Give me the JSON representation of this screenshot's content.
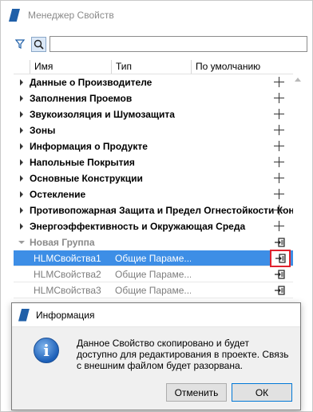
{
  "window": {
    "title": "Менеджер Свойств"
  },
  "search": {
    "value": "",
    "placeholder": ""
  },
  "columns": {
    "name": "Имя",
    "type": "Тип",
    "default": "По умолчанию"
  },
  "groups": [
    {
      "label": "Данные о Производителе"
    },
    {
      "label": "Заполнения Проемов"
    },
    {
      "label": "Звукоизоляция и Шумозащита"
    },
    {
      "label": "Зоны"
    },
    {
      "label": "Информация о Продукте"
    },
    {
      "label": "Напольные Покрытия"
    },
    {
      "label": "Основные Конструкции"
    },
    {
      "label": "Остекление"
    },
    {
      "label": "Противопожарная Защита и Предел Огнестойкости Конс"
    },
    {
      "label": "Энергоэффективность и Окружающая Среда"
    }
  ],
  "new_group": {
    "label": "Новая Группа",
    "items": [
      {
        "name": "HLMСвойства1",
        "type": "Общие Параме...",
        "selected": true
      },
      {
        "name": "HLMСвойства2",
        "type": "Общие Параме...",
        "selected": false
      },
      {
        "name": "HLMСвойства3",
        "type": "Общие Параме...",
        "selected": false
      }
    ]
  },
  "dialog": {
    "title": "Информация",
    "message": "Данное Свойство скопировано и будет доступно для редактирования в проекте. Связь с внешним файлом будет разорвана.",
    "cancel_label": "Отменить",
    "ok_label": "ОК"
  },
  "colors": {
    "selection": "#3d8ee6",
    "highlight_border": "#e0232f",
    "accent": "#1f5fa8"
  }
}
